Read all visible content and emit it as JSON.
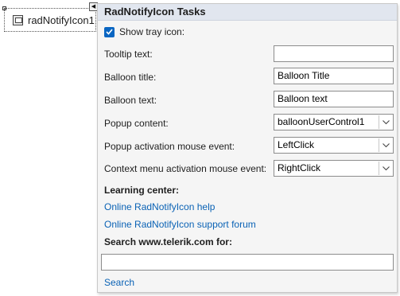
{
  "component": {
    "label": "radNotifyIcon1",
    "icon": "notify-icon",
    "smart_tag_glyph": "◀"
  },
  "panel": {
    "title": "RadNotifyIcon Tasks",
    "show_tray_icon": {
      "label": "Show tray icon:",
      "checked": true
    },
    "tooltip_text": {
      "label": "Tooltip text:",
      "value": ""
    },
    "balloon_title": {
      "label": "Balloon title:",
      "value": "Balloon Title"
    },
    "balloon_text": {
      "label": "Balloon text:",
      "value": "Balloon text"
    },
    "popup_content": {
      "label": "Popup content:",
      "value": "balloonUserControl1"
    },
    "popup_activation": {
      "label": "Popup activation mouse event:",
      "value": "LeftClick"
    },
    "context_menu_activation": {
      "label": "Context menu activation mouse event:",
      "value": "RightClick"
    },
    "learning_center": {
      "title": "Learning center:",
      "links": [
        "Online RadNotifyIcon help",
        "Online RadNotifyIcon support forum"
      ]
    },
    "search": {
      "title": "Search www.telerik.com for:",
      "value": "",
      "link": "Search"
    }
  },
  "colors": {
    "link": "#0a62b5",
    "checkbox": "#0a66c2",
    "header_bg": "#e1e6ef",
    "panel_bg": "#f5f5f5"
  }
}
